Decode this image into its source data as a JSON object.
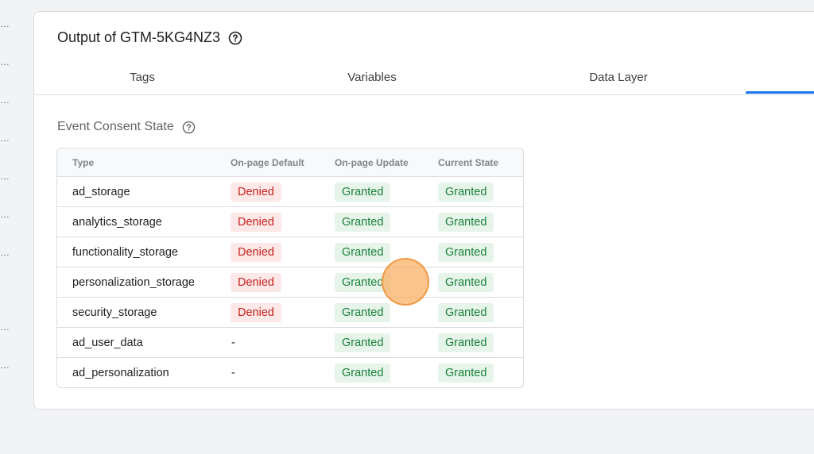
{
  "left_rail": {
    "dots": [
      "…",
      "…",
      "…",
      "…",
      "…",
      "…",
      "…",
      "…",
      "…"
    ]
  },
  "card": {
    "title": "Output of GTM-5KG4NZ3",
    "title_help_icon": "help-circle-icon"
  },
  "tabs": [
    {
      "label": "Tags"
    },
    {
      "label": "Variables"
    },
    {
      "label": "Data Layer"
    },
    {
      "label": ""
    }
  ],
  "active_tab_index": 3,
  "consent_section": {
    "title": "Event Consent State",
    "help_icon": "help-circle-icon",
    "columns": [
      "Type",
      "On-page Default",
      "On-page Update",
      "Current State"
    ],
    "rows": [
      {
        "type": "ad_storage",
        "default": "Denied",
        "update": "Granted",
        "current": "Granted"
      },
      {
        "type": "analytics_storage",
        "default": "Denied",
        "update": "Granted",
        "current": "Granted"
      },
      {
        "type": "functionality_storage",
        "default": "Denied",
        "update": "Granted",
        "current": "Granted"
      },
      {
        "type": "personalization_storage",
        "default": "Denied",
        "update": "Granted",
        "current": "Granted"
      },
      {
        "type": "security_storage",
        "default": "Denied",
        "update": "Granted",
        "current": "Granted"
      },
      {
        "type": "ad_user_data",
        "default": "-",
        "update": "Granted",
        "current": "Granted"
      },
      {
        "type": "ad_personalization",
        "default": "-",
        "update": "Granted",
        "current": "Granted"
      }
    ]
  },
  "colors": {
    "accent": "#1a73e8",
    "denied_bg": "#fce8e6",
    "denied_text": "#c5221f",
    "granted_bg": "#e6f4ea",
    "granted_text": "#188038",
    "cursor_highlight": "#faab5c"
  }
}
